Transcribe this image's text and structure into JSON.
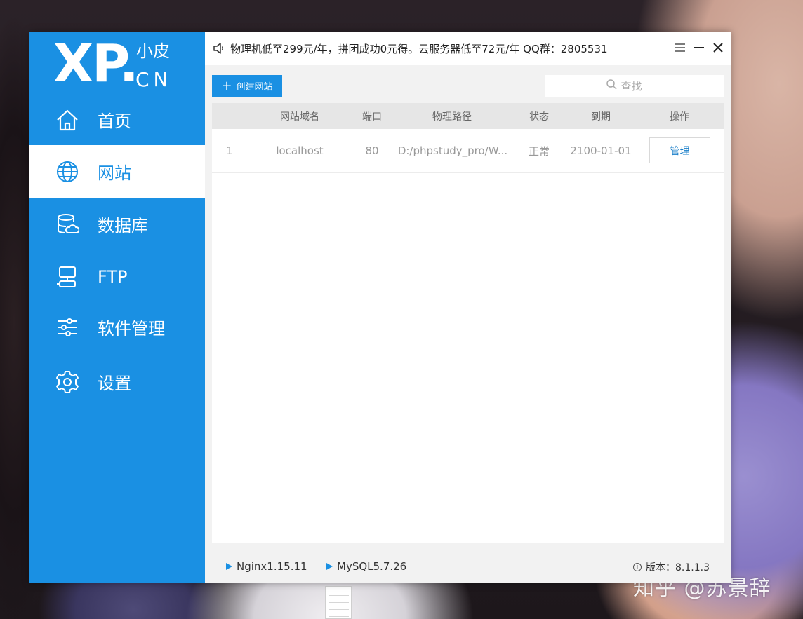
{
  "background": {
    "watermark": "知乎 @苏景辞"
  },
  "logo": {
    "xp": "XP.",
    "cn_small": "小皮",
    "cn": "CN"
  },
  "sidebar": {
    "items": [
      {
        "label": "首页",
        "icon": "home-icon",
        "active": false
      },
      {
        "label": "网站",
        "icon": "globe-icon",
        "active": true
      },
      {
        "label": "数据库",
        "icon": "database-icon",
        "active": false
      },
      {
        "label": "FTP",
        "icon": "ftp-icon",
        "active": false
      },
      {
        "label": "软件管理",
        "icon": "sliders-icon",
        "active": false
      },
      {
        "label": "设置",
        "icon": "gear-icon",
        "active": false
      }
    ]
  },
  "titlebar": {
    "notice": "物理机低至299元/年，拼团成功0元得。云服务器低至72元/年  QQ群：2805531"
  },
  "toolbar": {
    "create_label": "创建网站",
    "search_placeholder": "查找"
  },
  "table": {
    "headers": [
      "网站域名",
      "端口",
      "物理路径",
      "状态",
      "到期",
      "操作"
    ],
    "rows": [
      {
        "index": "1",
        "domain": "localhost",
        "port": "80",
        "path": "D:/phpstudy_pro/W...",
        "status": "正常",
        "expire": "2100-01-01",
        "action": "管理"
      }
    ]
  },
  "statusbar": {
    "nginx": "Nginx1.15.11",
    "mysql": "MySQL5.7.26",
    "version": "版本：8.1.1.3"
  },
  "colors": {
    "accent": "#1a90e3",
    "sidebar_bg": "#1a90e3",
    "content_bg": "#f2f2f2"
  }
}
